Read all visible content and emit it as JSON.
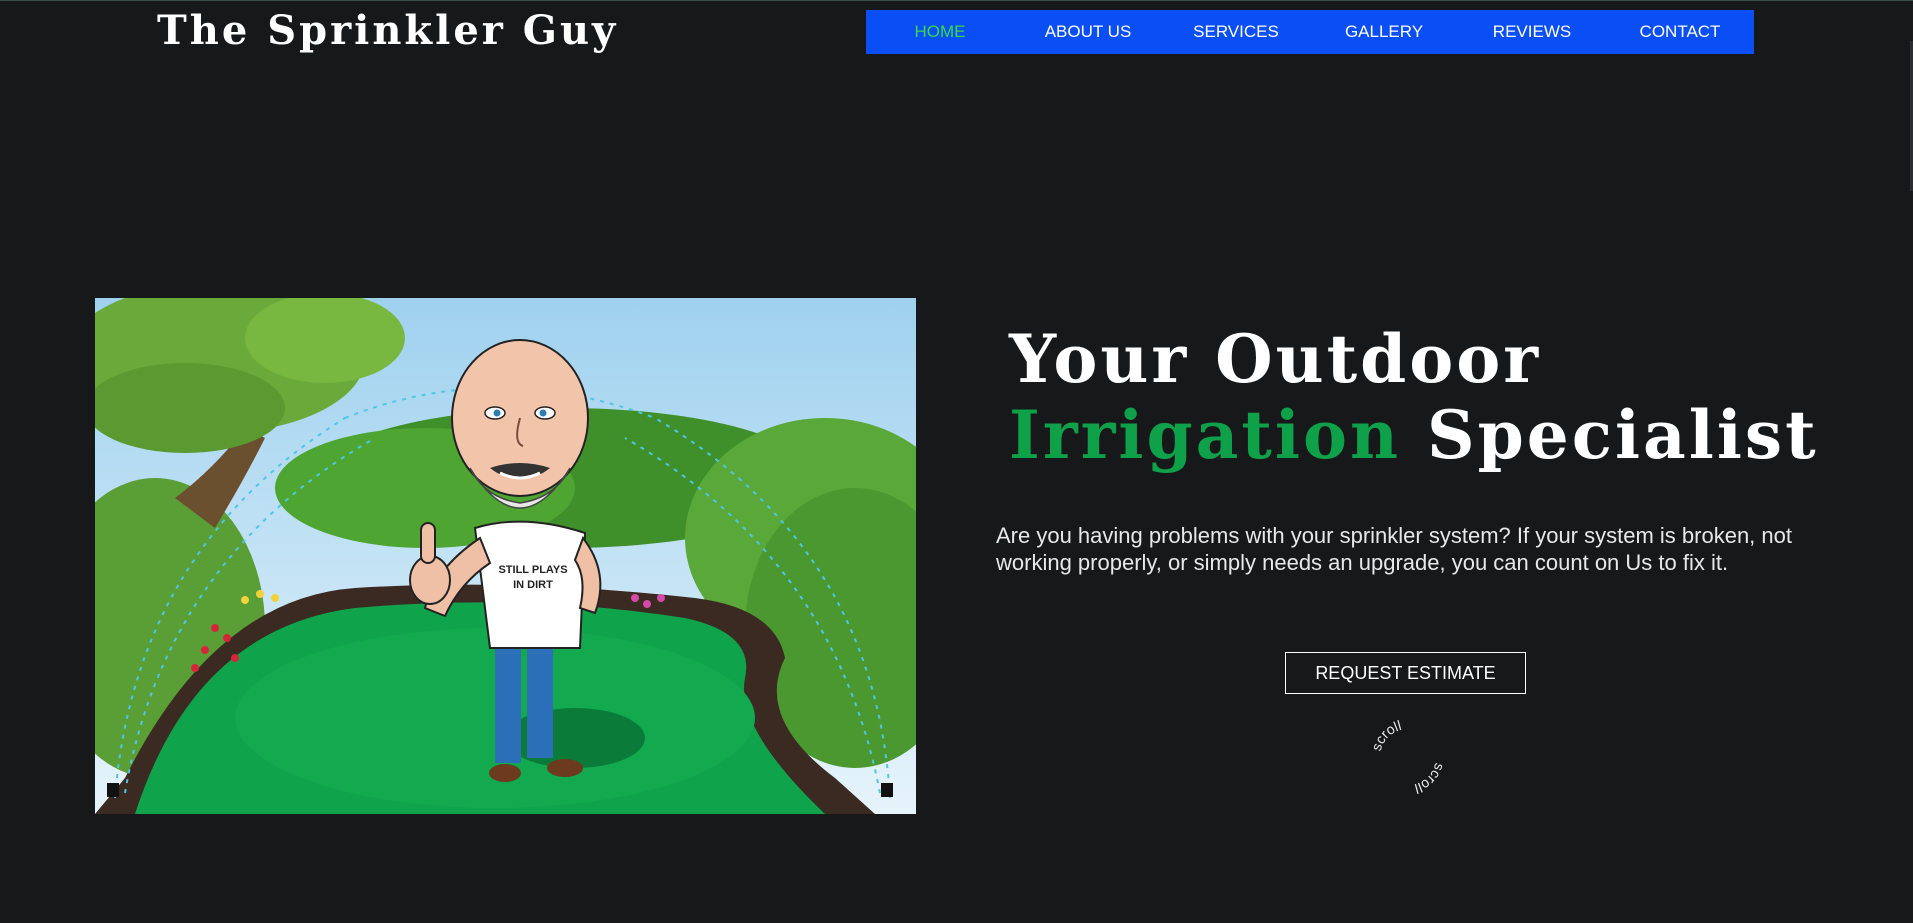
{
  "site": {
    "title": "The Sprinkler Guy"
  },
  "nav": {
    "items": [
      {
        "label": "HOME",
        "active": true
      },
      {
        "label": "ABOUT US"
      },
      {
        "label": "SERVICES"
      },
      {
        "label": "GALLERY"
      },
      {
        "label": "REVIEWS"
      },
      {
        "label": "CONTACT"
      }
    ],
    "background": "#0a4ef5",
    "active_color": "#3bd84a"
  },
  "hero": {
    "image_shirt_text": [
      "STILL PLAYS",
      "IN DIRT"
    ],
    "headline_line1": "Your Outdoor",
    "headline_green": "Irrigation",
    "headline_rest": "Specialist",
    "accent_color": "#0fa04a",
    "intro": "Are you having problems with your sprinkler system? If your system is broken, not working properly, or simply needs an upgrade, you can count on Us to fix it.",
    "cta_label": "REQUEST ESTIMATE",
    "scroll_label": "scroll"
  },
  "colors": {
    "page_background": "#17181a",
    "text": "#ffffff"
  }
}
